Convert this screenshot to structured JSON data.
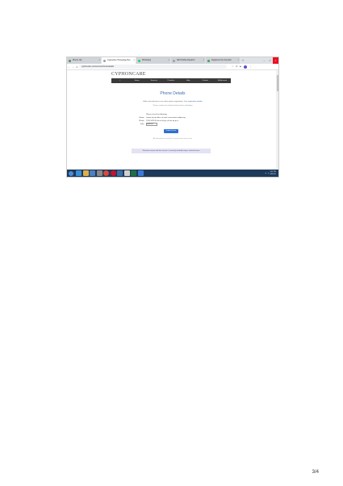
{
  "browser": {
    "tabs": [
      {
        "title": "Phenix.rdp",
        "favicon_color": "#5a8f5a",
        "active": false
      },
      {
        "title": "Cypuscare Homepage Rec",
        "favicon_color": "#9aa0a6",
        "active": true
      },
      {
        "title": "WhatsApp",
        "favicon_color": "#25d366",
        "active": false
      },
      {
        "title": "SET-Drabia Dispatch",
        "favicon_color": "#9aa0a6",
        "active": false
      },
      {
        "title": "Registered by Operator",
        "favicon_color": "#34a853",
        "active": false
      }
    ],
    "new_tab": "+",
    "window_controls": [
      "–",
      "□",
      "×"
    ],
    "url": "cyphoncare.com/service/home/details",
    "nav": [
      "←",
      "→",
      "C"
    ],
    "extensions": [
      "☆",
      "⧉",
      "▶",
      "⋮"
    ]
  },
  "page": {
    "brand": "CYPHONCARE",
    "menu": [
      "⌂",
      "Home",
      "Services",
      "Products",
      "Help",
      "Contact",
      "My Account"
    ],
    "title": "Phone Details",
    "intro": "Hello and welcome to our online phone registration. Your ",
    "intro_link": "registration details",
    "sub": "Please confirm the details below before submitting",
    "form": [
      {
        "label": "",
        "value": "Please check the following"
      },
      {
        "label": "Name:",
        "value": "Lorem ipsum dolor sit amet consectetur adipiscing"
      },
      {
        "label": "Phone:",
        "value": "1234 5678 90 ab cd ef gh ij kl mn op qr st"
      },
      {
        "label": "Date:",
        "value": "03/2021",
        "boxed": true
      }
    ],
    "submit_label": "Submit Form",
    "footnote": "All information provided is kept private and secure",
    "notice": "Please be aware that this service is currently available only in selected areas"
  },
  "taskbar": {
    "icons": [
      {
        "name": "ie-icon",
        "color": "#3a8fd6"
      },
      {
        "name": "folder-icon",
        "color": "#e0b04a"
      },
      {
        "name": "media-icon",
        "color": "#4e7fbf"
      },
      {
        "name": "settings-icon",
        "color": "#8a8a8a"
      },
      {
        "name": "chrome-icon",
        "color": "#d9483b"
      },
      {
        "name": "opera-icon",
        "color": "#c8102e"
      },
      {
        "name": "calendar-icon",
        "color": "#3b6ea5"
      },
      {
        "name": "document-icon",
        "color": "#d0d0d0"
      },
      {
        "name": "excel-icon",
        "color": "#1d7044"
      },
      {
        "name": "paint-icon",
        "color": "#3c7ad6"
      }
    ],
    "time": "2:04 PM",
    "date": "4/8/2021"
  },
  "page_number": "3/4"
}
